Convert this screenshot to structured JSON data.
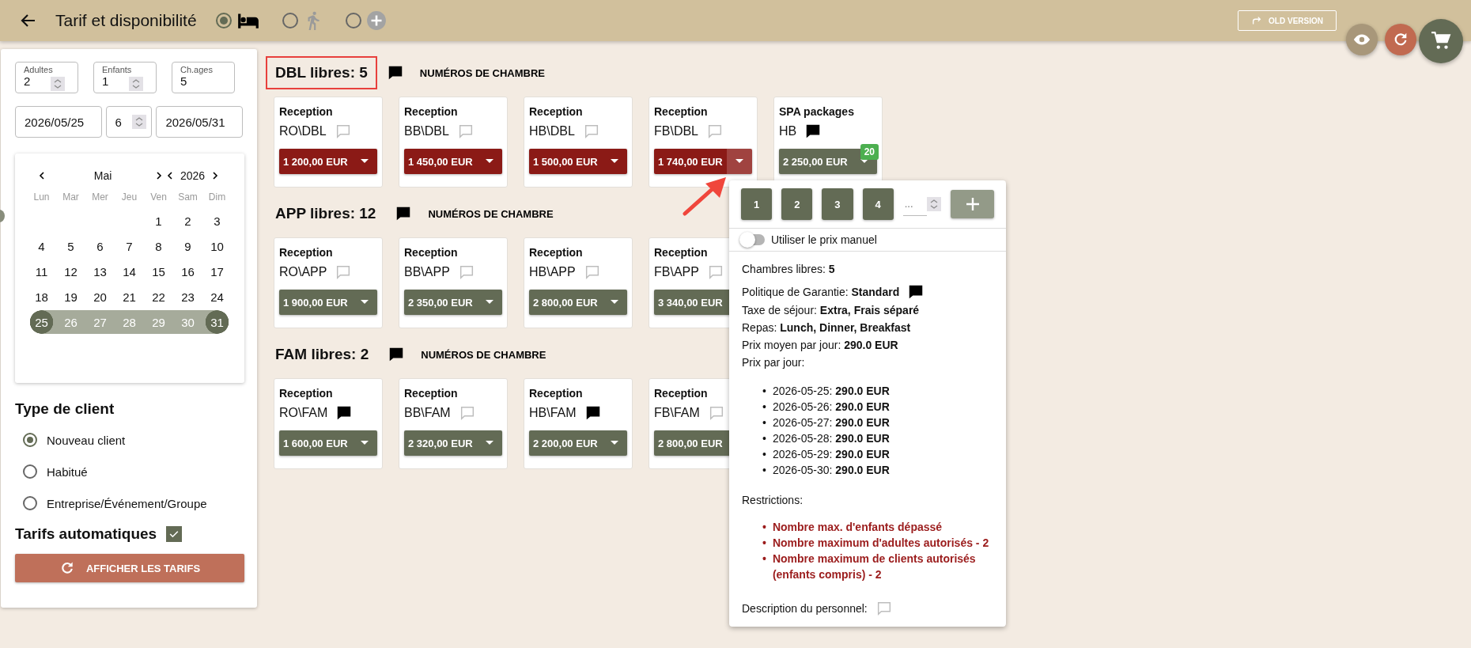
{
  "header": {
    "title": "Tarif et disponibilité",
    "modes": [
      {
        "kind": "bed",
        "selected": true
      },
      {
        "kind": "walk",
        "selected": false
      },
      {
        "kind": "add",
        "selected": false
      }
    ],
    "old_version": "OLD VERSION"
  },
  "guests": [
    {
      "label": "Adultes",
      "value": "2",
      "spinner": true
    },
    {
      "label": "Enfants",
      "value": "1",
      "spinner": true
    },
    {
      "label": "Ch.ages",
      "value": "5",
      "spinner": false
    }
  ],
  "dates": {
    "from": "2026/05/25",
    "nights": "6",
    "to": "2026/05/31"
  },
  "calendar": {
    "month": "Mai",
    "year": "2026",
    "weekdays": [
      "Lun",
      "Mar",
      "Mer",
      "Jeu",
      "Ven",
      "Sam",
      "Dim"
    ],
    "weeks": [
      [
        {
          "day": "1",
          "in_range": false,
          "selected": false
        },
        {
          "day": "2",
          "in_range": false,
          "selected": false
        },
        {
          "day": "3",
          "in_range": false,
          "selected": false
        }
      ],
      [
        {
          "day": "4",
          "in_range": false,
          "selected": false
        },
        {
          "day": "5",
          "in_range": false,
          "selected": false
        },
        {
          "day": "6",
          "in_range": false,
          "selected": false
        },
        {
          "day": "7",
          "in_range": false,
          "selected": false
        },
        {
          "day": "8",
          "in_range": false,
          "selected": false
        },
        {
          "day": "9",
          "in_range": false,
          "selected": false
        },
        {
          "day": "10",
          "in_range": false,
          "selected": false
        }
      ],
      [
        {
          "day": "11",
          "in_range": false,
          "selected": false
        },
        {
          "day": "12",
          "in_range": false,
          "selected": false
        },
        {
          "day": "13",
          "in_range": false,
          "selected": false
        },
        {
          "day": "14",
          "in_range": false,
          "selected": false
        },
        {
          "day": "15",
          "in_range": false,
          "selected": false
        },
        {
          "day": "16",
          "in_range": false,
          "selected": false
        },
        {
          "day": "17",
          "in_range": false,
          "selected": false
        }
      ],
      [
        {
          "day": "18",
          "in_range": false,
          "selected": false
        },
        {
          "day": "19",
          "in_range": false,
          "selected": false
        },
        {
          "day": "20",
          "in_range": false,
          "selected": false
        },
        {
          "day": "21",
          "in_range": false,
          "selected": false
        },
        {
          "day": "22",
          "in_range": false,
          "selected": false
        },
        {
          "day": "23",
          "in_range": false,
          "selected": false
        },
        {
          "day": "24",
          "in_range": false,
          "selected": false
        }
      ],
      [
        {
          "day": "25",
          "in_range": true,
          "selected": true
        },
        {
          "day": "26",
          "in_range": true,
          "selected": false
        },
        {
          "day": "27",
          "in_range": true,
          "selected": false
        },
        {
          "day": "28",
          "in_range": true,
          "selected": false
        },
        {
          "day": "29",
          "in_range": true,
          "selected": false
        },
        {
          "day": "30",
          "in_range": true,
          "selected": false
        },
        {
          "day": "31",
          "in_range": true,
          "selected": true
        }
      ]
    ]
  },
  "client_type": {
    "title": "Type de client",
    "options": [
      {
        "label": "Nouveau client",
        "selected": true
      },
      {
        "label": "Habitué",
        "selected": false
      },
      {
        "label": "Entreprise/Événement/Groupe",
        "selected": false
      }
    ]
  },
  "auto_rates": {
    "label": "Tarifs automatiques",
    "checked": true
  },
  "show_button": "AFFICHER LES TARIFS",
  "sections": [
    {
      "title": "DBL libres: 5",
      "highlighted": true,
      "rooms_button": "NUMÉROS DE CHAMBRE",
      "cards": [
        {
          "channel": "Reception",
          "code": "RO\\DBL",
          "has_comment": false,
          "price": "1 200,00 EUR",
          "restricted": true,
          "open": false
        },
        {
          "channel": "Reception",
          "code": "BB\\DBL",
          "has_comment": false,
          "price": "1 450,00 EUR",
          "restricted": true,
          "open": false
        },
        {
          "channel": "Reception",
          "code": "HB\\DBL",
          "has_comment": false,
          "price": "1 500,00 EUR",
          "restricted": true,
          "open": false
        },
        {
          "channel": "Reception",
          "code": "FB\\DBL",
          "has_comment": false,
          "price": "1 740,00 EUR",
          "restricted": true,
          "open": true
        },
        {
          "channel": "SPA packages",
          "code": "HB",
          "has_comment": true,
          "price": "2 250,00 EUR",
          "restricted": false,
          "open": false,
          "badge": "20"
        }
      ]
    },
    {
      "title": "APP libres: 12",
      "highlighted": false,
      "rooms_button": "NUMÉROS DE CHAMBRE",
      "cards": [
        {
          "channel": "Reception",
          "code": "RO\\APP",
          "has_comment": false,
          "price": "1 900,00 EUR",
          "restricted": false,
          "open": false
        },
        {
          "channel": "Reception",
          "code": "BB\\APP",
          "has_comment": false,
          "price": "2 350,00 EUR",
          "restricted": false,
          "open": false
        },
        {
          "channel": "Reception",
          "code": "HB\\APP",
          "has_comment": false,
          "price": "2 800,00 EUR",
          "restricted": false,
          "open": false
        },
        {
          "channel": "Reception",
          "code": "FB\\APP",
          "has_comment": false,
          "price": "3 340,00 EUR",
          "restricted": false,
          "open": false,
          "caret_covered": true
        }
      ]
    },
    {
      "title": "FAM libres: 2",
      "highlighted": false,
      "rooms_button": "NUMÉROS DE CHAMBRE",
      "cards": [
        {
          "channel": "Reception",
          "code": "RO\\FAM",
          "has_comment": true,
          "price": "1 600,00 EUR",
          "restricted": false,
          "open": false
        },
        {
          "channel": "Reception",
          "code": "BB\\FAM",
          "has_comment": false,
          "price": "2 320,00 EUR",
          "restricted": false,
          "open": false
        },
        {
          "channel": "Reception",
          "code": "HB\\FAM",
          "has_comment": true,
          "price": "2 200,00 EUR",
          "restricted": false,
          "open": false
        },
        {
          "channel": "Reception",
          "code": "FB\\FAM",
          "has_comment": false,
          "price": "2 800,00 EUR",
          "restricted": false,
          "open": false,
          "caret_covered": true
        }
      ]
    }
  ],
  "popup": {
    "quick_buttons": [
      "1",
      "2",
      "3",
      "4"
    ],
    "quantity_placeholder": "...",
    "add_disabled": true,
    "manual_price": {
      "label": "Utiliser le prix manuel",
      "on": false
    },
    "lines": [
      {
        "kind": "plain",
        "text": "Chambres libres: **5**"
      },
      {
        "kind": "commented",
        "text": "Politique de Garantie: **Standard**"
      },
      {
        "kind": "plain",
        "text": "Taxe de séjour: **Extra, Frais séparé**"
      },
      {
        "kind": "plain",
        "text": "Repas: **Lunch, Dinner, Breakfast**"
      },
      {
        "kind": "plain",
        "text": "Prix moyen par jour: **290.0 EUR**"
      },
      {
        "kind": "plain",
        "text": "Prix par jour:"
      }
    ],
    "daily_prices": [
      {
        "bullet": "•",
        "text": "2026-05-25: **290.0 EUR**"
      },
      {
        "bullet": "•",
        "text": "2026-05-26: **290.0 EUR**"
      },
      {
        "bullet": "•",
        "text": "2026-05-27: **290.0 EUR**"
      },
      {
        "bullet": "•",
        "text": "2026-05-28: **290.0 EUR**"
      },
      {
        "bullet": "•",
        "text": "2026-05-29: **290.0 EUR**"
      },
      {
        "bullet": "•",
        "text": "2026-05-30: **290.0 EUR**"
      }
    ],
    "restrictions_label": "Restrictions:",
    "restrictions": [
      {
        "bullet": "•",
        "text": "Nombre max. d'enfants dépassé"
      },
      {
        "bullet": "•",
        "text": "Nombre maximum d'adultes autorisés - 2"
      },
      {
        "bullet": "•",
        "text": "Nombre maximum de clients autorisés (enfants compris) - 2"
      }
    ],
    "staff_description": {
      "label": "Description du personnel:",
      "has_comment": false
    }
  }
}
